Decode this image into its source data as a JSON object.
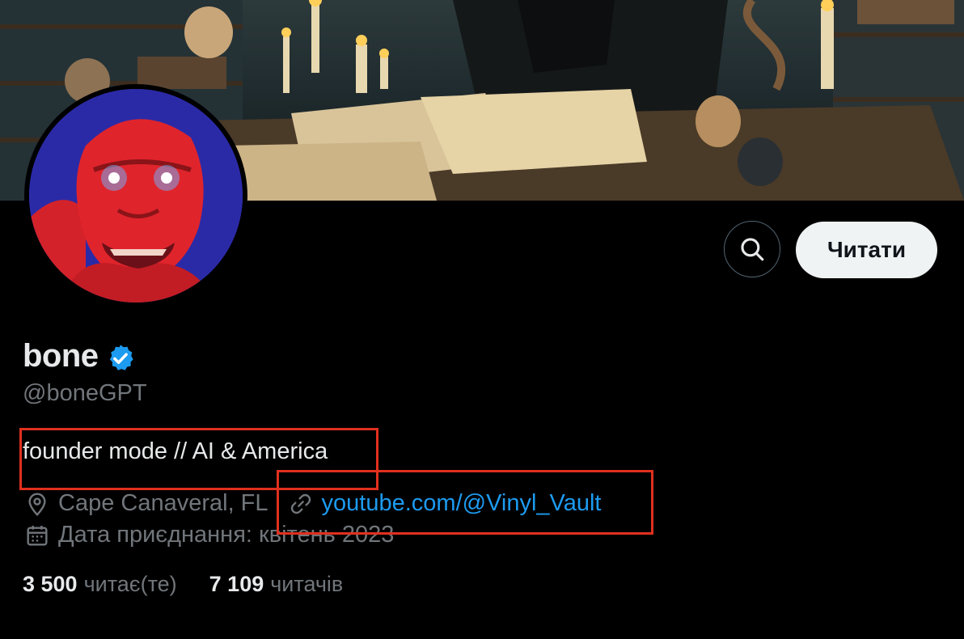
{
  "profile": {
    "name": "bone",
    "handle": "@boneGPT",
    "bio": "founder mode // AI & America",
    "location": "Cape Canaveral, FL",
    "website": "youtube.com/@Vinyl_Vault",
    "joined": "Дата приєднання: квітень 2023",
    "verified": true
  },
  "actions": {
    "follow_label": "Читати"
  },
  "stats": {
    "following_count": "3 500",
    "following_label": "читає(те)",
    "followers_count": "7 109",
    "followers_label": "читачів"
  },
  "colors": {
    "accent": "#1d9bf0",
    "background": "#000000",
    "highlight": "#e0301e"
  },
  "icons": [
    "search-icon",
    "verified-badge-icon",
    "location-icon",
    "link-icon",
    "calendar-icon"
  ]
}
